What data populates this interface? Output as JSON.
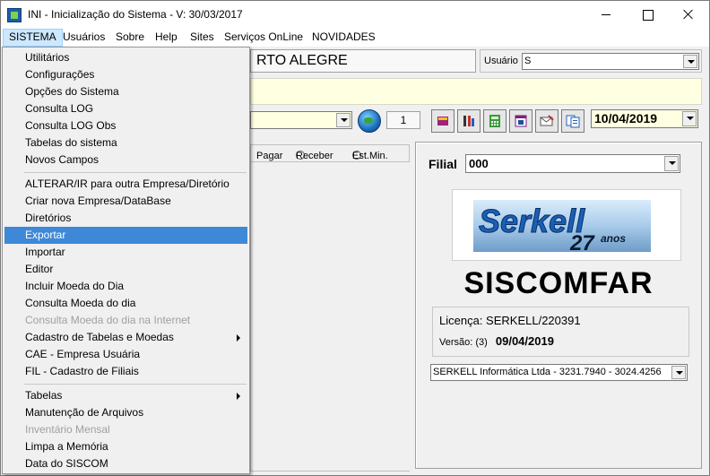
{
  "window": {
    "title": "INI - Inicialização do Sistema - V: 30/03/2017"
  },
  "menubar": [
    "SISTEMA",
    "Usuários",
    "Sobre",
    "Help",
    "Sites",
    "Serviços OnLine",
    "NOVIDADES"
  ],
  "dropdown": {
    "group1": [
      "Utilitários",
      "Configurações",
      "Opções do Sistema",
      "Consulta LOG",
      "Consulta LOG Obs",
      "Tabelas do sistema",
      "Novos Campos"
    ],
    "group2": [
      "ALTERAR/IR para outra Empresa/Diretório",
      "Criar nova Empresa/DataBase",
      "Diretórios",
      "Exportar",
      "Importar",
      "Editor",
      "Incluir Moeda do Dia",
      "Consulta Moeda do dia",
      "Consulta Moeda do dia na Internet",
      "Cadastro de Tabelas e Moedas",
      "CAE - Empresa Usuária",
      "FIL - Cadastro de Filiais"
    ],
    "group3": [
      "Tabelas",
      "Manutenção de Arquivos",
      "Inventário Mensal",
      "Limpa a Memória",
      "Data do SISCOM"
    ],
    "highlighted": "Exportar",
    "disabled": [
      "Consulta Moeda do dia na Internet",
      "Inventário Mensal"
    ]
  },
  "header": {
    "city": "RTO ALEGRE",
    "user_label": "Usuário",
    "user_value": "S"
  },
  "toolbar": {
    "counter": "1",
    "date": "10/04/2019"
  },
  "radios": [
    "Pagar",
    "Receber",
    "Est.Min."
  ],
  "right": {
    "filial_label": "Filial",
    "filial_value": "000",
    "logo_brand": "Serkell",
    "logo_years": "27",
    "logo_anos": "anos",
    "product": "SISCOMFAR",
    "license_label": "Licença:",
    "license_value": "SERKELL/220391",
    "version_label": "Versão: (3)",
    "version_date": "09/04/2019",
    "contact": "SERKELL Informática Ltda - 3231.7940 - 3024.4256"
  },
  "colors": {
    "highlight": "#3e88d8",
    "yellow": "#ffffe1",
    "menu_active": "#cce8ff"
  }
}
